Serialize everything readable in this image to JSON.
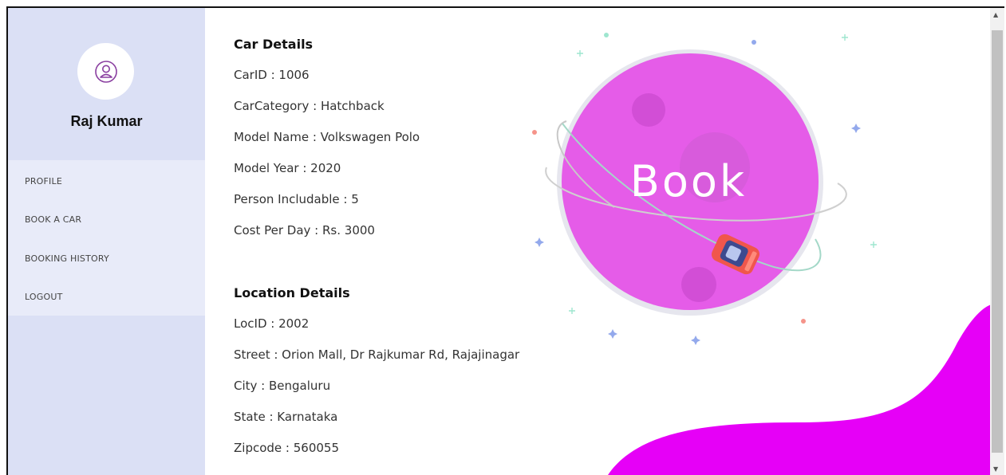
{
  "sidebar": {
    "user_name": "Raj Kumar",
    "menu": [
      {
        "label": "PROFILE"
      },
      {
        "label": "BOOK A CAR"
      },
      {
        "label": "BOOKING HISTORY"
      },
      {
        "label": "LOGOUT"
      }
    ]
  },
  "car_details": {
    "title": "Car Details",
    "car_id": "CarID : 1006",
    "category": "CarCategory : Hatchback",
    "model_name": "Model Name : Volkswagen Polo",
    "model_year": "Model Year : 2020",
    "persons": "Person Includable : 5",
    "cost": "Cost Per Day : Rs. 3000"
  },
  "location_details": {
    "title": "Location Details",
    "loc_id": "LocID : 2002",
    "street": "Street : Orion Mall, Dr Rajkumar Rd, Rajajinagar",
    "city": "City : Bengaluru",
    "state": "State : Karnataka",
    "zipcode": "Zipcode : 560055"
  },
  "illustration": {
    "planet_text": "Book",
    "planet_color": "#e55ce8",
    "wave_color": "#e600f7"
  },
  "icons": {
    "avatar": "user-icon",
    "scroll_up": "scroll-up-arrow",
    "scroll_down": "scroll-down-arrow"
  }
}
